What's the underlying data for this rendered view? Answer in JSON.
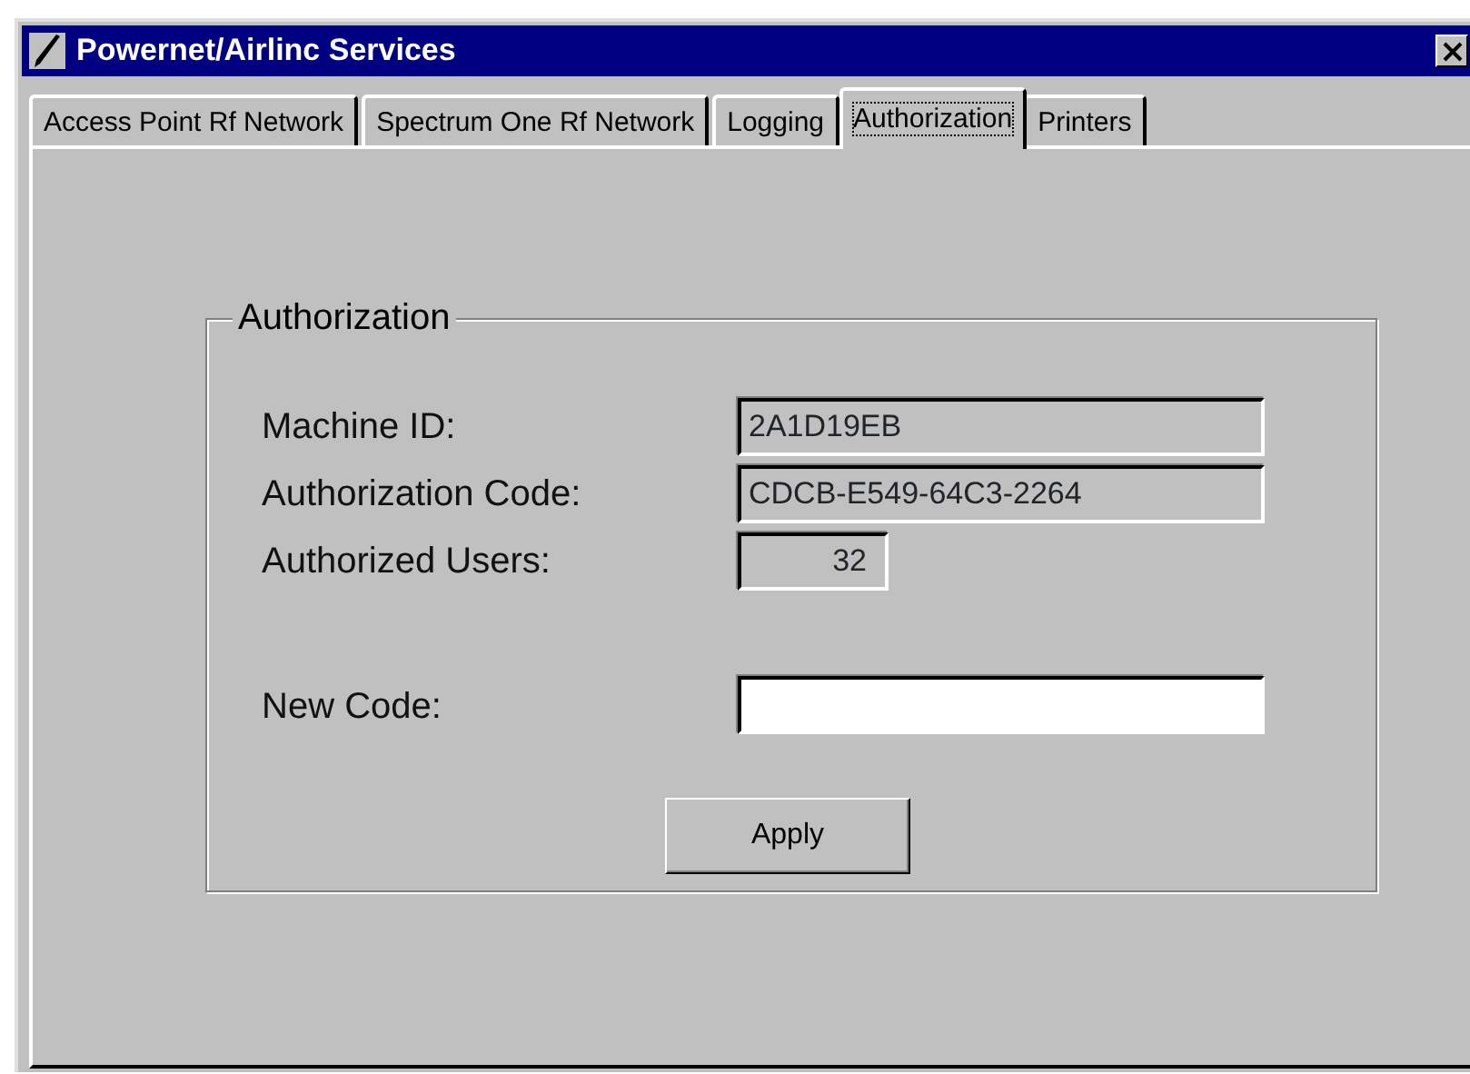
{
  "window": {
    "title": "Powernet/Airlinc Services"
  },
  "tabs": [
    {
      "label": "Access Point Rf Network",
      "selected": false
    },
    {
      "label": "Spectrum One Rf Network",
      "selected": false
    },
    {
      "label": "Logging",
      "selected": false
    },
    {
      "label": "Authorization",
      "selected": true
    },
    {
      "label": "Printers",
      "selected": false
    }
  ],
  "group": {
    "title": "Authorization",
    "fields": [
      {
        "label": "Machine ID:",
        "value": "2A1D19EB",
        "kind": "readonly"
      },
      {
        "label": "Authorization Code:",
        "value": "CDCB-E549-64C3-2264",
        "kind": "readonly"
      },
      {
        "label": "Authorized Users:",
        "value": "32",
        "kind": "number"
      },
      {
        "label": "New Code:",
        "kind": "input"
      }
    ],
    "button": "Apply"
  }
}
